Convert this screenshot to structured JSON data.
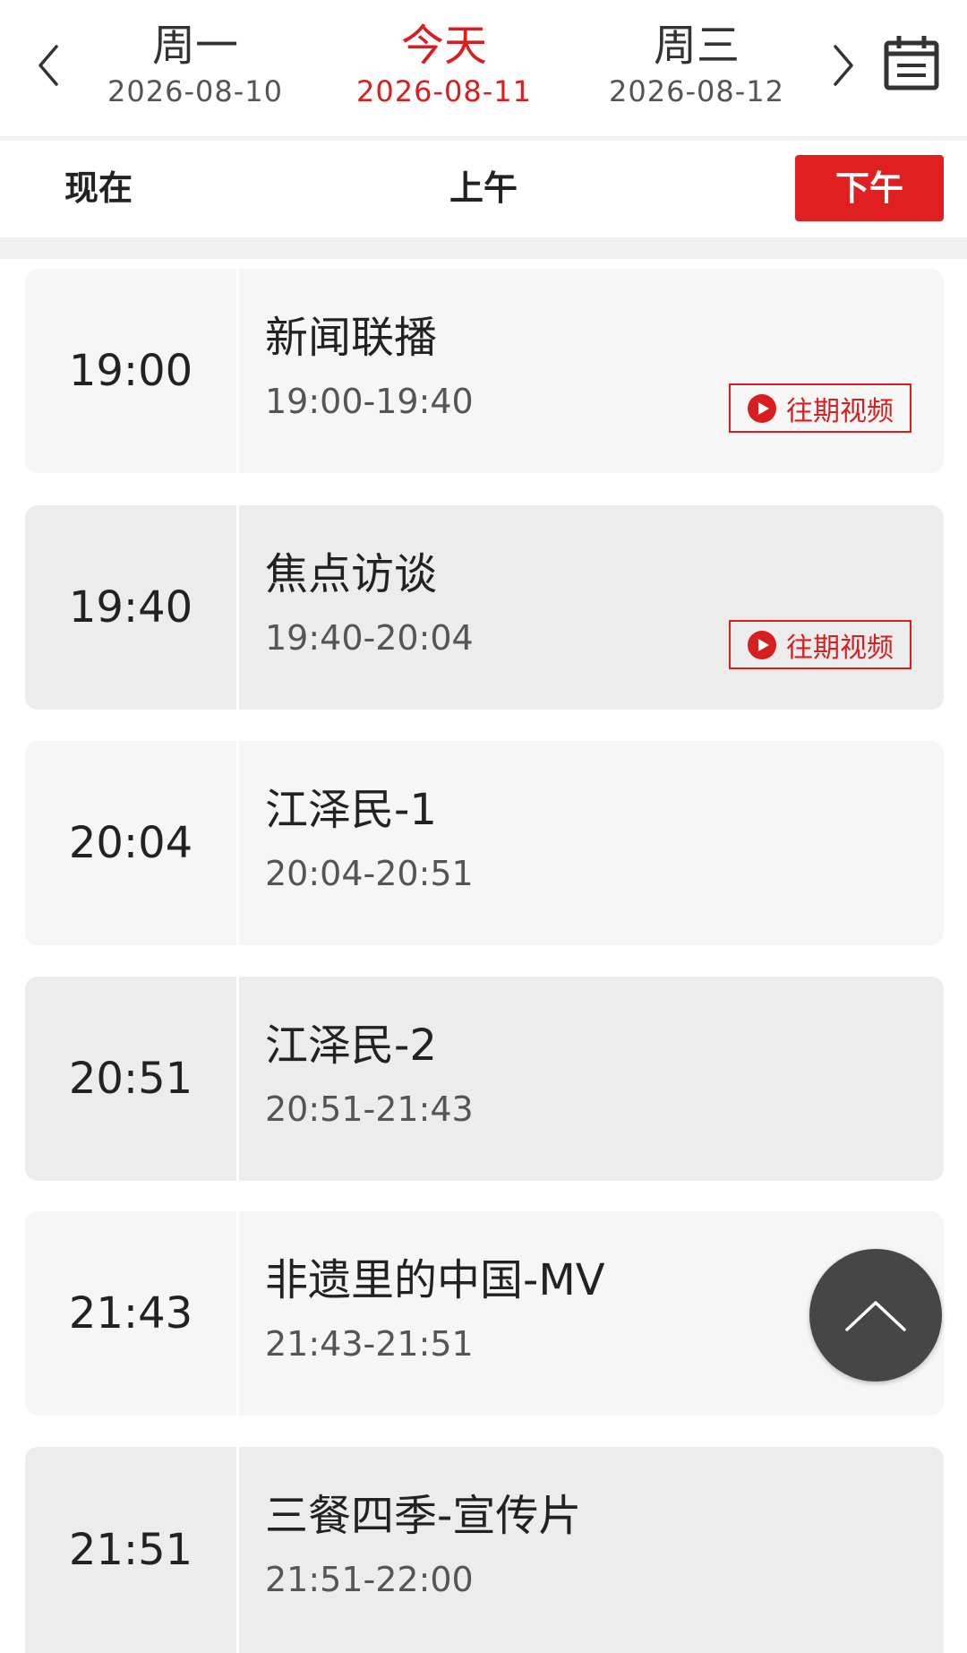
{
  "date_nav": {
    "prev_icon": "chevron-left-icon",
    "next_icon": "chevron-right-icon",
    "calendar_icon": "calendar-icon",
    "days": [
      {
        "name": "周一",
        "date": "2026-08-10",
        "active": false
      },
      {
        "name": "今天",
        "date": "2026-08-11",
        "active": true
      },
      {
        "name": "周三",
        "date": "2026-08-12",
        "active": false
      }
    ]
  },
  "period_tabs": {
    "now": "现在",
    "morning": "上午",
    "afternoon": "下午",
    "selected": "下午"
  },
  "programs": [
    {
      "time": "19:00",
      "title": "新闻联播",
      "range": "19:00-19:40",
      "replay": "往期视频"
    },
    {
      "time": "19:40",
      "title": "焦点访谈",
      "range": "19:40-20:04",
      "replay": "往期视频"
    },
    {
      "time": "20:04",
      "title": "江泽民-1",
      "range": "20:04-20:51"
    },
    {
      "time": "20:51",
      "title": "江泽民-2",
      "range": "20:51-21:43"
    },
    {
      "time": "21:43",
      "title": "非遗里的中国-MV",
      "range": "21:43-21:51"
    },
    {
      "time": "21:51",
      "title": "三餐四季-宣传片",
      "range": "21:51-22:00"
    }
  ],
  "back_to_top": {
    "icon": "chevron-up-icon"
  },
  "colors": {
    "accent": "#d81e1e",
    "selected_tab_bg": "#e02020",
    "card_light": "#f6f6f6",
    "card_dark": "#ececec",
    "fab": "#464646"
  }
}
